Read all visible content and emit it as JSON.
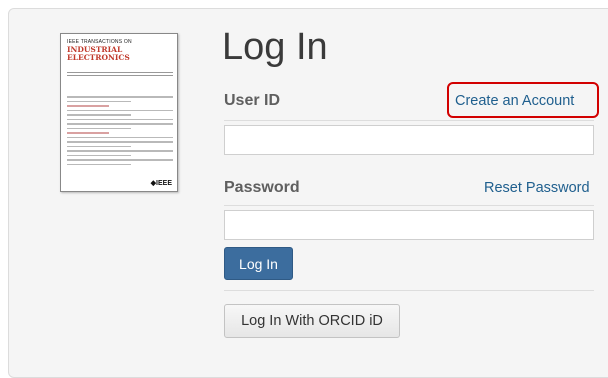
{
  "cover": {
    "top_text": "IEEE TRANSACTIONS ON",
    "title_line1": "INDUSTRIAL",
    "title_line2": "ELECTRONICS",
    "logo_text": "◆IEEE"
  },
  "login": {
    "heading": "Log In",
    "user_id_label": "User ID",
    "create_account_link": "Create an Account",
    "password_label": "Password",
    "reset_password_link": "Reset Password",
    "login_button": "Log In",
    "orcid_button": "Log In With ORCID iD"
  },
  "colors": {
    "link": "#1f5f8e",
    "primary_button": "#3c6d9e",
    "highlight_box": "#d20000"
  }
}
